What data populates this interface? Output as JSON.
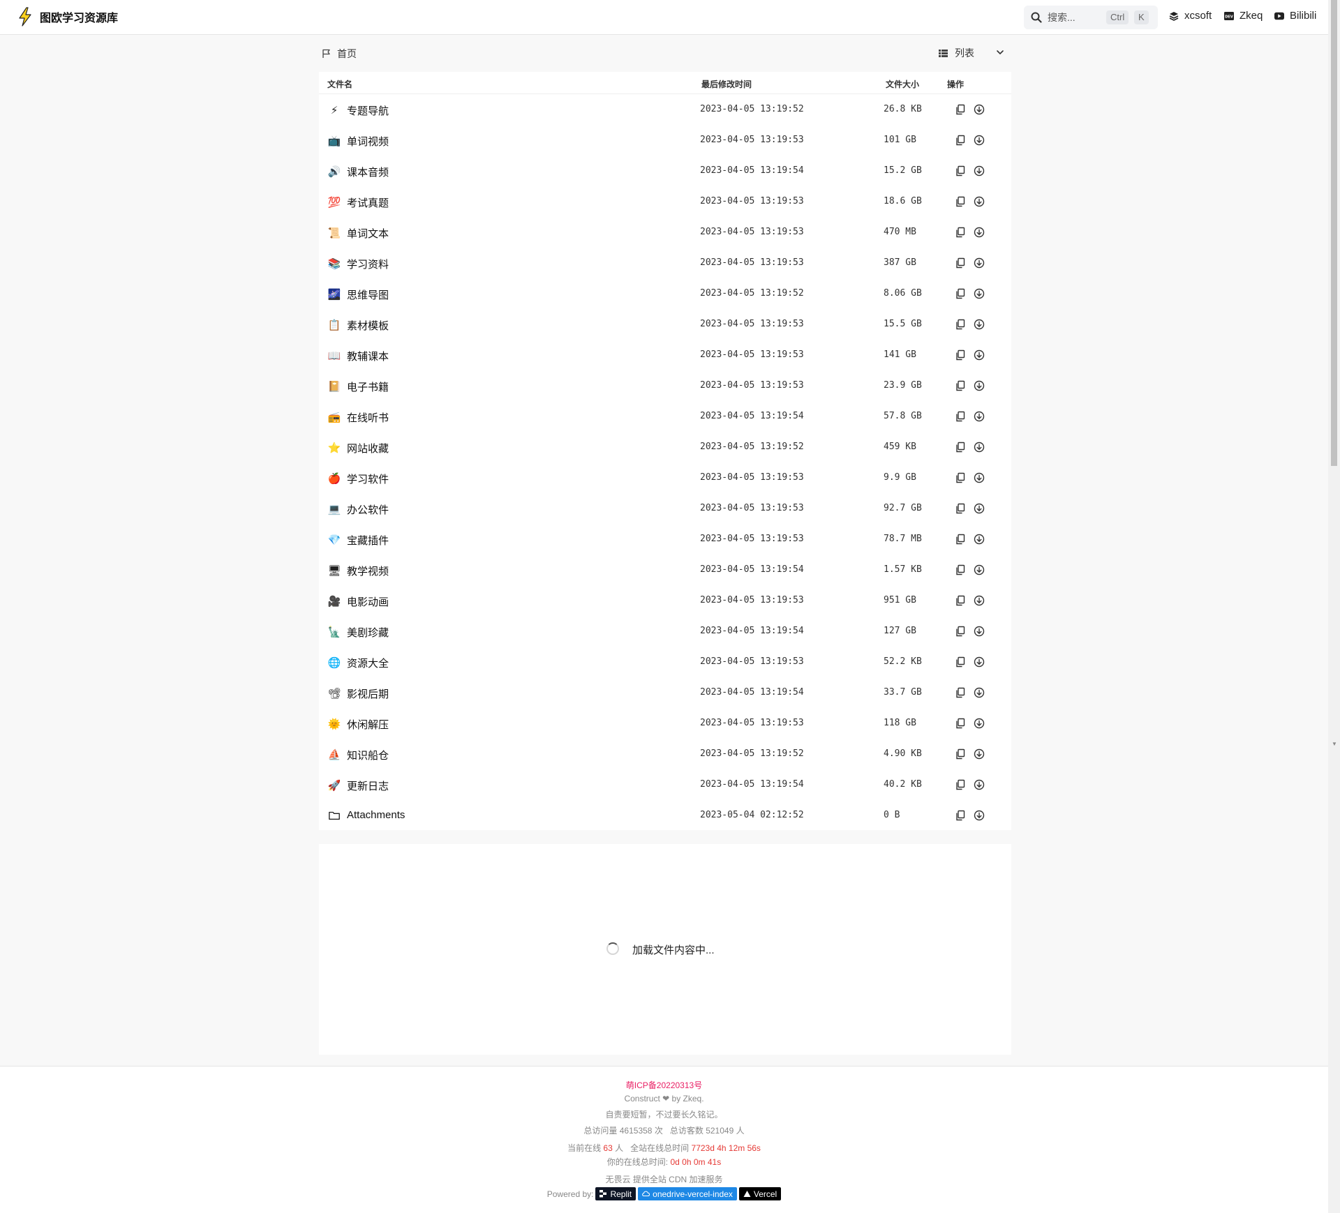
{
  "header": {
    "site_title": "图欧学习资源库",
    "search_placeholder": "搜索...",
    "kbd_ctrl": "Ctrl",
    "kbd_k": "K",
    "links": [
      {
        "label": "xcsoft",
        "icon": "stack-icon"
      },
      {
        "label": "Zkeq",
        "icon": "dev-icon"
      },
      {
        "label": "Bilibili",
        "icon": "youtube-play-icon"
      }
    ]
  },
  "breadcrumb": {
    "home_label": "首页"
  },
  "view_switch": {
    "label": "列表"
  },
  "table": {
    "columns": {
      "name": "文件名",
      "modified": "最后修改时间",
      "size": "文件大小",
      "actions": "操作"
    },
    "rows": [
      {
        "icon": "⚡",
        "name": "专题导航",
        "modified": "2023-04-05 13:19:52",
        "size": "26.8 KB"
      },
      {
        "icon": "📺",
        "name": "单词视频",
        "modified": "2023-04-05 13:19:53",
        "size": "101 GB"
      },
      {
        "icon": "🔊",
        "name": "课本音频",
        "modified": "2023-04-05 13:19:54",
        "size": "15.2 GB"
      },
      {
        "icon": "💯",
        "name": "考试真题",
        "modified": "2023-04-05 13:19:53",
        "size": "18.6 GB"
      },
      {
        "icon": "📜",
        "name": "单词文本",
        "modified": "2023-04-05 13:19:53",
        "size": "470 MB"
      },
      {
        "icon": "📚",
        "name": "学习资料",
        "modified": "2023-04-05 13:19:53",
        "size": "387 GB"
      },
      {
        "icon": "🌌",
        "name": "思维导图",
        "modified": "2023-04-05 13:19:52",
        "size": "8.06 GB"
      },
      {
        "icon": "📋",
        "name": "素材模板",
        "modified": "2023-04-05 13:19:53",
        "size": "15.5 GB"
      },
      {
        "icon": "📖",
        "name": "教辅课本",
        "modified": "2023-04-05 13:19:53",
        "size": "141 GB"
      },
      {
        "icon": "📔",
        "name": "电子书籍",
        "modified": "2023-04-05 13:19:53",
        "size": "23.9 GB"
      },
      {
        "icon": "📻",
        "name": "在线听书",
        "modified": "2023-04-05 13:19:54",
        "size": "57.8 GB"
      },
      {
        "icon": "⭐",
        "name": "网站收藏",
        "modified": "2023-04-05 13:19:52",
        "size": "459 KB"
      },
      {
        "icon": "🍎",
        "name": "学习软件",
        "modified": "2023-04-05 13:19:53",
        "size": "9.9 GB"
      },
      {
        "icon": "💻",
        "name": "办公软件",
        "modified": "2023-04-05 13:19:53",
        "size": "92.7 GB"
      },
      {
        "icon": "💎",
        "name": "宝藏插件",
        "modified": "2023-04-05 13:19:53",
        "size": "78.7 MB"
      },
      {
        "icon": "🖥",
        "name": "教学视频",
        "modified": "2023-04-05 13:19:54",
        "size": "1.57 KB"
      },
      {
        "icon": "🎥",
        "name": "电影动画",
        "modified": "2023-04-05 13:19:53",
        "size": "951 GB"
      },
      {
        "icon": "🗽",
        "name": "美剧珍藏",
        "modified": "2023-04-05 13:19:54",
        "size": "127 GB"
      },
      {
        "icon": "🌐",
        "name": "资源大全",
        "modified": "2023-04-05 13:19:53",
        "size": "52.2 KB"
      },
      {
        "icon": "📽",
        "name": "影视后期",
        "modified": "2023-04-05 13:19:54",
        "size": "33.7 GB"
      },
      {
        "icon": "🌞",
        "name": "休闲解压",
        "modified": "2023-04-05 13:19:53",
        "size": "118 GB"
      },
      {
        "icon": "⛵",
        "name": "知识船仓",
        "modified": "2023-04-05 13:19:52",
        "size": "4.90 KB"
      },
      {
        "icon": "🚀",
        "name": "更新日志",
        "modified": "2023-04-05 13:19:54",
        "size": "40.2 KB"
      },
      {
        "icon": "folder-icon",
        "name": "Attachments",
        "modified": "2023-05-04 02:12:52",
        "size": "0 B"
      }
    ]
  },
  "loading": {
    "text": "加载文件内容中..."
  },
  "footer": {
    "icp": "萌ICP备20220313号",
    "construct": "Construct ❤ by Zkeq.",
    "motto": "自责要短暂，不过要长久铭记。",
    "visits_prefix": "总访问量",
    "visits": "4615358",
    "visits_unit": "次",
    "visitors_prefix": "总访客数",
    "visitors": "521049",
    "visitors_unit": "人",
    "online_prefix": "当前在线",
    "online": "63",
    "online_unit": "人",
    "total_time_prefix": "全站在线总时间",
    "total_time": "7723d 4h 12m 56s",
    "your_time_prefix": "你的在线总时间:",
    "your_time": "0d 0h 0m 41s",
    "cdn": "无畏云 提供全站 CDN 加速服务",
    "powered_by": "Powered by:",
    "badges": [
      "Replit",
      "onedrive-vercel-index",
      "Vercel"
    ]
  },
  "colors": {
    "accent_red": "#e53935",
    "icp_pink": "#e91e63",
    "badge_blue": "#1e88e5"
  }
}
